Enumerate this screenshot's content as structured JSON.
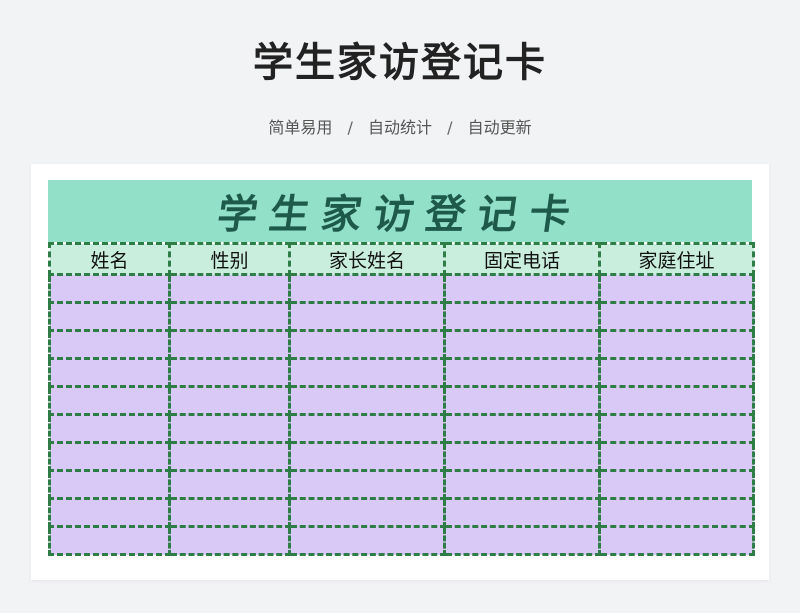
{
  "header": {
    "title": "学生家访登记卡",
    "features": [
      "简单易用",
      "自动统计",
      "自动更新"
    ],
    "separator": "/"
  },
  "sheet": {
    "banner_title": "学生家访登记卡",
    "columns": [
      "姓名",
      "性别",
      "家长姓名",
      "固定电话",
      "家庭住址"
    ],
    "empty_rows": 10
  },
  "colors": {
    "banner_bg": "#93e0c8",
    "header_bg": "#c9eede",
    "row_bg": "#d8c9f7",
    "border": "#2e7d46",
    "banner_text": "#1e5a4a"
  }
}
